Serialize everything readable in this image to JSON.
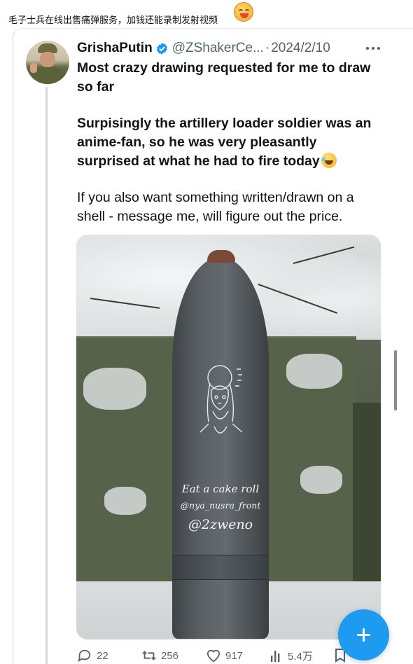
{
  "caption": {
    "text": "毛子士兵在线出售痛弹服务，加钱还能录制发射视频"
  },
  "icons": {
    "caption_emoji": "grinning-sweat-emoji",
    "verified": "verified-badge-icon",
    "more": "more-dots-icon",
    "reply": "reply-icon",
    "retweet": "retweet-icon",
    "like": "heart-icon",
    "views": "views-icon",
    "bookmark": "bookmark-icon",
    "compose": "compose-plus-icon"
  },
  "colors": {
    "accent": "#1d9bf0",
    "text": "#0f1419",
    "muted": "#536471"
  },
  "tweet": {
    "display_name": "GrishaPutin",
    "handle": "@ZShakerCe...",
    "separator": "·",
    "date": "2024/2/10",
    "paragraph1": "Most crazy drawing requested for me to draw so far",
    "paragraph2": "Surpisingly the artillery loader soldier was an anime-fan, so he was very pleasantly surprised at what he had to fire today",
    "paragraph3": "If you also want something written/drawn on a shell - message me, will figure out the price.",
    "shell_text": {
      "line1": "Eat a cake roll",
      "line2": "@nya_nusra_front",
      "line3": "@2zweno"
    }
  },
  "stats": {
    "replies": "22",
    "retweets": "256",
    "likes": "917",
    "views": "5.4万"
  }
}
